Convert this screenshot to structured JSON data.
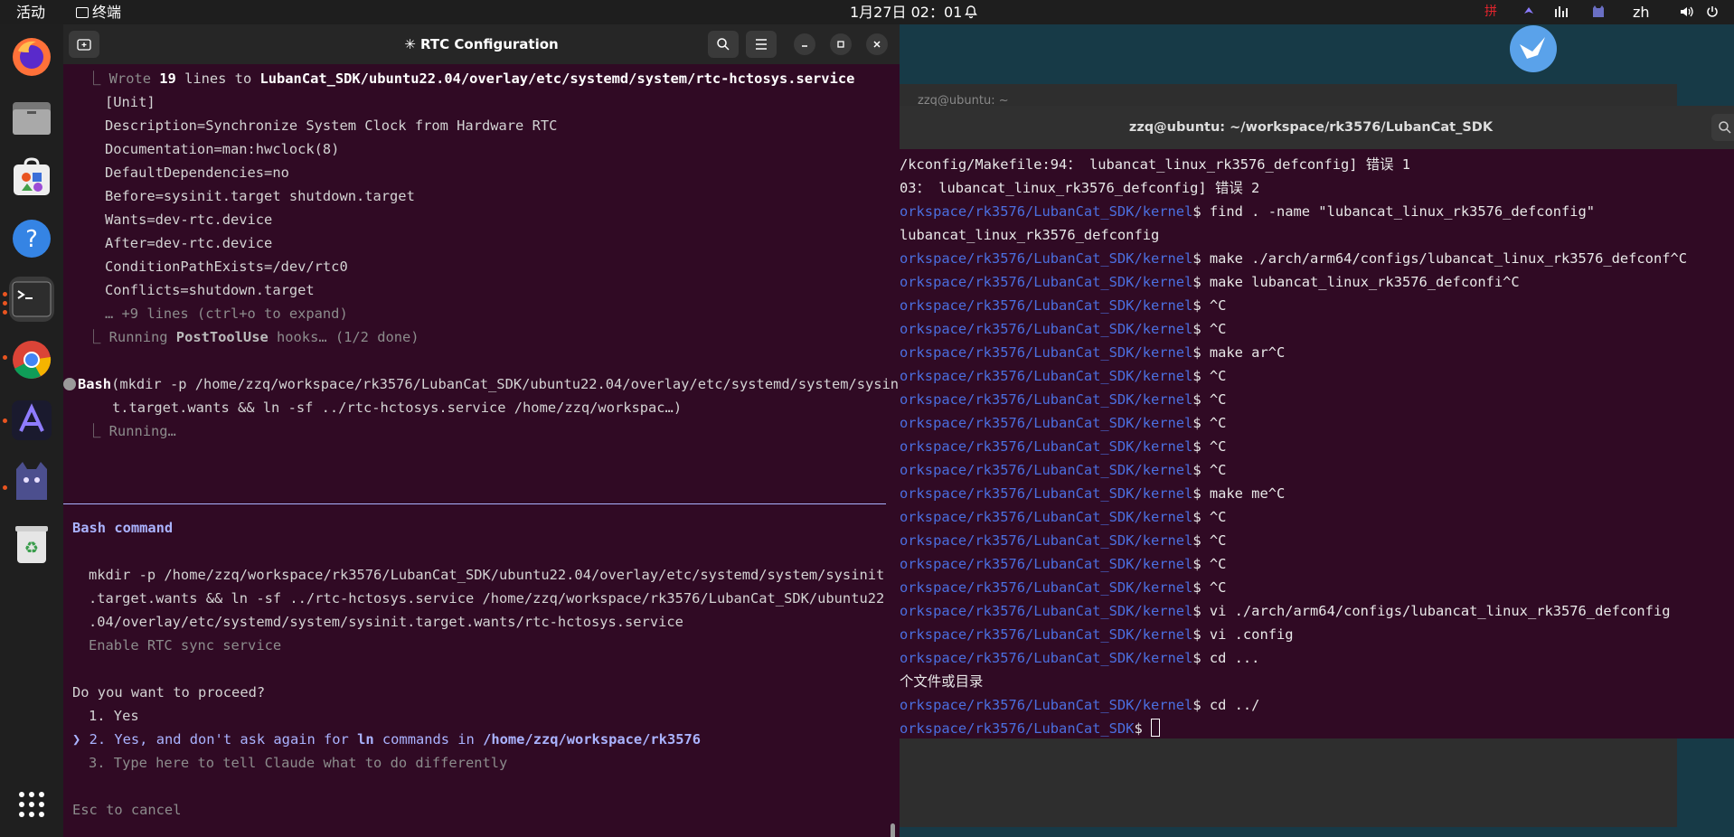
{
  "topbar": {
    "activities": "活动",
    "app_name": "终端",
    "datetime": "1月27日 02：01",
    "ime": "拼",
    "lang": "zh"
  },
  "dock": {
    "items": [
      "firefox-icon",
      "files-icon",
      "app-center-icon",
      "help-icon",
      "terminal-icon",
      "chrome-icon",
      "ai-app-icon",
      "cat-app-icon",
      "trash-icon",
      "show-apps-icon"
    ]
  },
  "term1": {
    "title": "✳ RTC Configuration",
    "lines": {
      "l1_a": "⎿ Wrote ",
      "l1_b": "19",
      "l1_c": " lines to ",
      "l1_d": "LubanCat_SDK/ubuntu22.04/overlay/etc/systemd/system/rtc-hctosys.service",
      "l2": "[Unit]",
      "l3": "Description=Synchronize System Clock from Hardware RTC",
      "l4": "Documentation=man:hwclock(8)",
      "l5": "DefaultDependencies=no",
      "l6": "Before=sysinit.target shutdown.target",
      "l7": "Wants=dev-rtc.device",
      "l8": "After=dev-rtc.device",
      "l9": "ConditionPathExists=/dev/rtc0",
      "l10": "Conflicts=shutdown.target",
      "l11": "… +9 lines (ctrl+o to expand)",
      "l12_a": "⎿ Running ",
      "l12_b": "PostToolUse",
      "l12_c": " hooks… (1/2 done)",
      "l13_a": "Bash",
      "l13_b": "(mkdir -p /home/zzq/workspace/rk3576/LubanCat_SDK/ubuntu22.04/overlay/etc/systemd/system/sysinit",
      "l14": "t.target.wants && ln -sf ../rtc-hctosys.service /home/zzq/workspac…)",
      "l15": "⎿ Running…",
      "section": "Bash command",
      "c1": "mkdir -p /home/zzq/workspace/rk3576/LubanCat_SDK/ubuntu22.04/overlay/etc/systemd/system/sysinit",
      "c2": ".target.wants && ln -sf ../rtc-hctosys.service /home/zzq/workspace/rk3576/LubanCat_SDK/ubuntu22",
      "c3": ".04/overlay/etc/systemd/system/sysinit.target.wants/rtc-hctosys.service",
      "c4": "Enable RTC sync service",
      "q": "Do you want to proceed?",
      "o1": "1. Yes",
      "o2_pointer": "❯",
      "o2_a": "2. Yes, and don't ask again for ",
      "o2_b": "ln",
      "o2_c": " commands in ",
      "o2_d": "/home/zzq/workspace/rk3576",
      "o3": "3. Type here to tell Claude what to do differently",
      "esc": "Esc to cancel"
    }
  },
  "term2": {
    "back_title": "zzq@ubuntu: ~",
    "title": "zzq@ubuntu: ~/workspace/rk3576/LubanCat_SDK",
    "lines": [
      {
        "p": "",
        "c": "/kconfig/Makefile:94： lubancat_linux_rk3576_defconfig] 错误 1"
      },
      {
        "p": "",
        "c": "03： lubancat_linux_rk3576_defconfig] 错误 2"
      },
      {
        "p": "orkspace/rk3576/LubanCat_SDK/kernel",
        "c": "$ find . -name \"lubancat_linux_rk3576_defconfig\""
      },
      {
        "p": "",
        "c": "lubancat_linux_rk3576_defconfig"
      },
      {
        "p": "orkspace/rk3576/LubanCat_SDK/kernel",
        "c": "$ make ./arch/arm64/configs/lubancat_linux_rk3576_defconf^C"
      },
      {
        "p": "orkspace/rk3576/LubanCat_SDK/kernel",
        "c": "$ make lubancat_linux_rk3576_defconfi^C"
      },
      {
        "p": "orkspace/rk3576/LubanCat_SDK/kernel",
        "c": "$ ^C"
      },
      {
        "p": "orkspace/rk3576/LubanCat_SDK/kernel",
        "c": "$ ^C"
      },
      {
        "p": "orkspace/rk3576/LubanCat_SDK/kernel",
        "c": "$ make ar^C"
      },
      {
        "p": "orkspace/rk3576/LubanCat_SDK/kernel",
        "c": "$ ^C"
      },
      {
        "p": "orkspace/rk3576/LubanCat_SDK/kernel",
        "c": "$ ^C"
      },
      {
        "p": "orkspace/rk3576/LubanCat_SDK/kernel",
        "c": "$ ^C"
      },
      {
        "p": "orkspace/rk3576/LubanCat_SDK/kernel",
        "c": "$ ^C"
      },
      {
        "p": "orkspace/rk3576/LubanCat_SDK/kernel",
        "c": "$ ^C"
      },
      {
        "p": "orkspace/rk3576/LubanCat_SDK/kernel",
        "c": "$ make me^C"
      },
      {
        "p": "orkspace/rk3576/LubanCat_SDK/kernel",
        "c": "$ ^C"
      },
      {
        "p": "orkspace/rk3576/LubanCat_SDK/kernel",
        "c": "$ ^C"
      },
      {
        "p": "orkspace/rk3576/LubanCat_SDK/kernel",
        "c": "$ ^C"
      },
      {
        "p": "orkspace/rk3576/LubanCat_SDK/kernel",
        "c": "$ ^C"
      },
      {
        "p": "orkspace/rk3576/LubanCat_SDK/kernel",
        "c": "$ vi ./arch/arm64/configs/lubancat_linux_rk3576_defconfig"
      },
      {
        "p": "orkspace/rk3576/LubanCat_SDK/kernel",
        "c": "$ vi .config"
      },
      {
        "p": "orkspace/rk3576/LubanCat_SDK/kernel",
        "c": "$ cd ..."
      },
      {
        "p": "",
        "c": "个文件或目录"
      },
      {
        "p": "orkspace/rk3576/LubanCat_SDK/kernel",
        "c": "$ cd ../"
      },
      {
        "p": "orkspace/rk3576/LubanCat_SDK",
        "c": "$ "
      }
    ]
  }
}
